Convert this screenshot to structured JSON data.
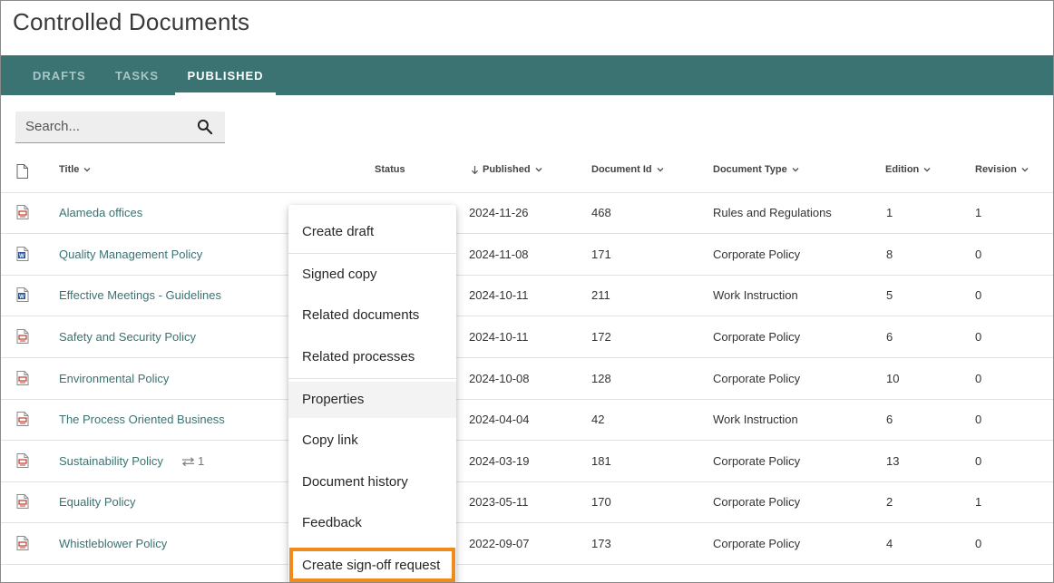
{
  "page_title": "Controlled Documents",
  "tabs": [
    {
      "label": "DRAFTS",
      "active": false
    },
    {
      "label": "TASKS",
      "active": false
    },
    {
      "label": "PUBLISHED",
      "active": true
    }
  ],
  "search": {
    "placeholder": "Search..."
  },
  "columns": {
    "title": "Title",
    "status": "Status",
    "published": "Published",
    "document_id": "Document Id",
    "document_type": "Document Type",
    "edition": "Edition",
    "revision": "Revision"
  },
  "rows": [
    {
      "icon": "pdf-file-icon",
      "title": "Alameda offices",
      "published": "2024-11-26",
      "document_id": "468",
      "document_type": "Rules and Regulations",
      "edition": "1",
      "revision": "1"
    },
    {
      "icon": "word-file-icon",
      "title": "Quality Management Policy",
      "published": "2024-11-08",
      "document_id": "171",
      "document_type": "Corporate Policy",
      "edition": "8",
      "revision": "0"
    },
    {
      "icon": "word-file-icon",
      "title": "Effective Meetings - Guidelines",
      "published": "2024-10-11",
      "document_id": "211",
      "document_type": "Work Instruction",
      "edition": "5",
      "revision": "0"
    },
    {
      "icon": "pdf-file-icon",
      "title": "Safety and Security Policy",
      "published": "2024-10-11",
      "document_id": "172",
      "document_type": "Corporate Policy",
      "edition": "6",
      "revision": "0"
    },
    {
      "icon": "pdf-file-icon",
      "title": "Environmental Policy",
      "published": "2024-10-08",
      "document_id": "128",
      "document_type": "Corporate Policy",
      "edition": "10",
      "revision": "0"
    },
    {
      "icon": "pdf-file-icon",
      "title": "The Process Oriented Business",
      "published": "2024-04-04",
      "document_id": "42",
      "document_type": "Work Instruction",
      "edition": "6",
      "revision": "0"
    },
    {
      "icon": "pdf-file-icon",
      "title": "Sustainability Policy",
      "link_count": "1",
      "published": "2024-03-19",
      "document_id": "181",
      "document_type": "Corporate Policy",
      "edition": "13",
      "revision": "0"
    },
    {
      "icon": "pdf-file-icon",
      "title": "Equality Policy",
      "published": "2023-05-11",
      "document_id": "170",
      "document_type": "Corporate Policy",
      "edition": "2",
      "revision": "1"
    },
    {
      "icon": "pdf-file-icon",
      "title": "Whistleblower Policy",
      "published": "2022-09-07",
      "document_id": "173",
      "document_type": "Corporate Policy",
      "edition": "4",
      "revision": "0"
    }
  ],
  "context_menu": {
    "items": [
      "Create draft",
      "Signed copy",
      "Related documents",
      "Related processes",
      "Properties",
      "Copy link",
      "Document history",
      "Feedback",
      "Create sign-off request"
    ],
    "highlight_color": "#f08a1c"
  },
  "colors": {
    "tab_bar": "#3b7272",
    "link": "#3b7272",
    "pdf_icon": "#c0392b",
    "word_icon": "#2b579a"
  }
}
